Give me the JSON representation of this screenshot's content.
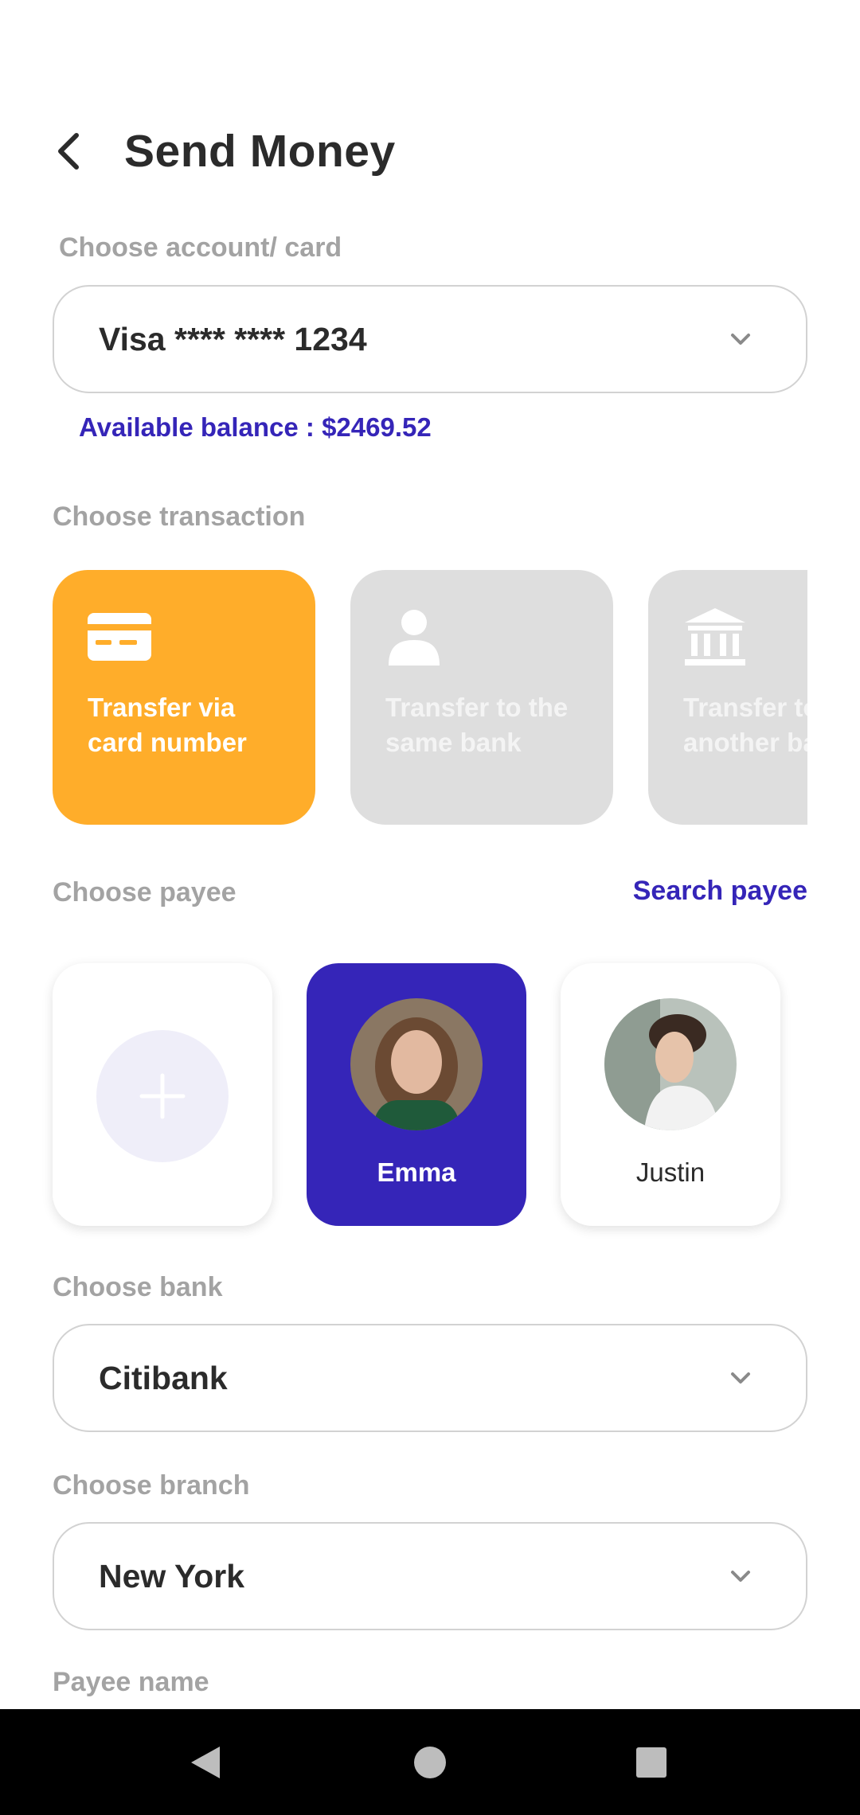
{
  "header": {
    "title": "Send Money"
  },
  "account": {
    "label": "Choose account/ card",
    "value": "Visa **** **** 1234",
    "balance": "Available balance : $2469.52"
  },
  "transaction": {
    "label": "Choose transaction",
    "options": [
      {
        "label": "Transfer via card number",
        "icon": "credit-card-icon",
        "selected": true
      },
      {
        "label": "Transfer to the same bank",
        "icon": "person-icon",
        "selected": false
      },
      {
        "label": "Transfer to another bank",
        "icon": "bank-icon",
        "selected": false
      }
    ]
  },
  "payee": {
    "label": "Choose payee",
    "search_label": "Search payee",
    "items": [
      {
        "name": "",
        "type": "add"
      },
      {
        "name": "Emma",
        "selected": true
      },
      {
        "name": "Justin",
        "selected": false
      }
    ]
  },
  "bank": {
    "label": "Choose bank",
    "value": "Citibank"
  },
  "branch": {
    "label": "Choose branch",
    "value": "New York"
  },
  "payee_name": {
    "label": "Payee name"
  },
  "colors": {
    "accent": "#3525b8",
    "selected_card": "#ffad2a",
    "inactive_card": "#dedede"
  }
}
